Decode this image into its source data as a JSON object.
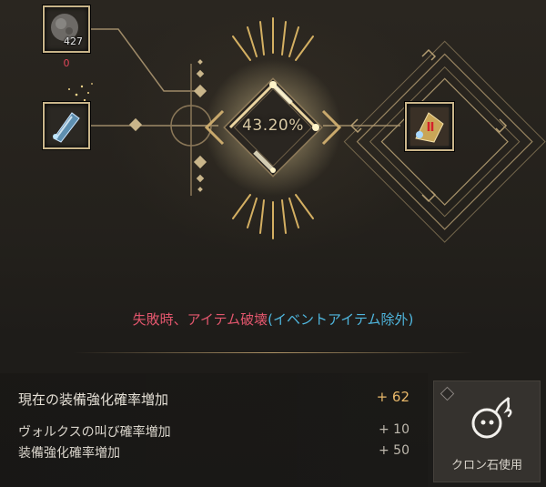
{
  "materials": {
    "stone_count": "427",
    "stone_extra": "0"
  },
  "enhance": {
    "chance": "43.20%"
  },
  "warning": {
    "main": "失敗時、アイテム破壊",
    "note": "(イベントアイテム除外)"
  },
  "stats": {
    "current_label": "現在の装備強化確率増加",
    "current_value": "+ 62",
    "vorks_label": "ヴォルクスの叫び確率増加",
    "vorks_value": "+ 10",
    "equip_label": "装備強化確率増加",
    "equip_value": "+ 50"
  },
  "cron_button": {
    "label": "クロン石使用"
  },
  "colors": {
    "accent_gold": "#e8b86a",
    "warning_red": "#e2566d",
    "warning_blue": "#4fb6de",
    "zero_red": "#e0455a"
  }
}
